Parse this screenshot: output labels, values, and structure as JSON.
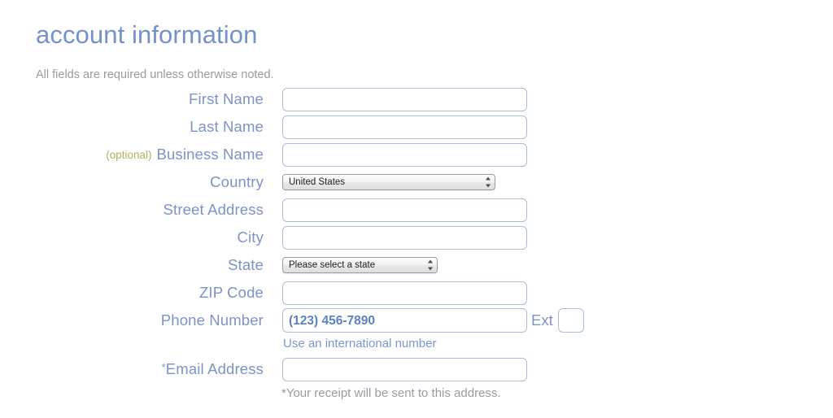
{
  "header": {
    "title": "account information",
    "subtitle": "All fields are required unless otherwise noted."
  },
  "colors": {
    "title": "#7390cf",
    "label": "#7c93c8",
    "optional_tag": "#b3b05e",
    "input_border": "#a8bcdd",
    "placeholder": "#5b80c4",
    "helper_gray": "#9b9b9b",
    "link": "#7b97cf",
    "background": "#ffffff"
  },
  "form": {
    "fields": [
      {
        "name": "first-name",
        "label": "First Name",
        "optional_tag": "",
        "required_mark": "",
        "control": "text",
        "value": "",
        "placeholder": ""
      },
      {
        "name": "last-name",
        "label": "Last Name",
        "optional_tag": "",
        "required_mark": "",
        "control": "text",
        "value": "",
        "placeholder": ""
      },
      {
        "name": "business-name",
        "label": "Business Name",
        "optional_tag": "(optional)",
        "required_mark": "",
        "control": "text",
        "value": "",
        "placeholder": ""
      },
      {
        "name": "country",
        "label": "Country",
        "optional_tag": "",
        "required_mark": "",
        "control": "select",
        "value": "United States",
        "options": [
          "United States"
        ]
      },
      {
        "name": "street-address",
        "label": "Street Address",
        "optional_tag": "",
        "required_mark": "",
        "control": "text",
        "value": "",
        "placeholder": ""
      },
      {
        "name": "city",
        "label": "City",
        "optional_tag": "",
        "required_mark": "",
        "control": "text",
        "value": "",
        "placeholder": ""
      },
      {
        "name": "state",
        "label": "State",
        "optional_tag": "",
        "required_mark": "",
        "control": "select",
        "value": "Please select a state",
        "options": [
          "Please select a state"
        ]
      },
      {
        "name": "zip-code",
        "label": "ZIP Code",
        "optional_tag": "",
        "required_mark": "",
        "control": "text",
        "value": "",
        "placeholder": ""
      },
      {
        "name": "phone-number",
        "label": "Phone Number",
        "optional_tag": "",
        "required_mark": "",
        "control": "phone",
        "value": "",
        "placeholder": "(123) 456-7890",
        "ext_label": "Ext",
        "ext_value": "",
        "helper_link": "Use an international number"
      },
      {
        "name": "email-address",
        "label": "Email Address",
        "optional_tag": "",
        "required_mark": "*",
        "control": "text",
        "value": "",
        "placeholder": "",
        "helper_note": "*Your receipt will be sent to this address."
      }
    ]
  },
  "icons": {
    "select_stepper": "select-stepper-arrows-icon"
  }
}
